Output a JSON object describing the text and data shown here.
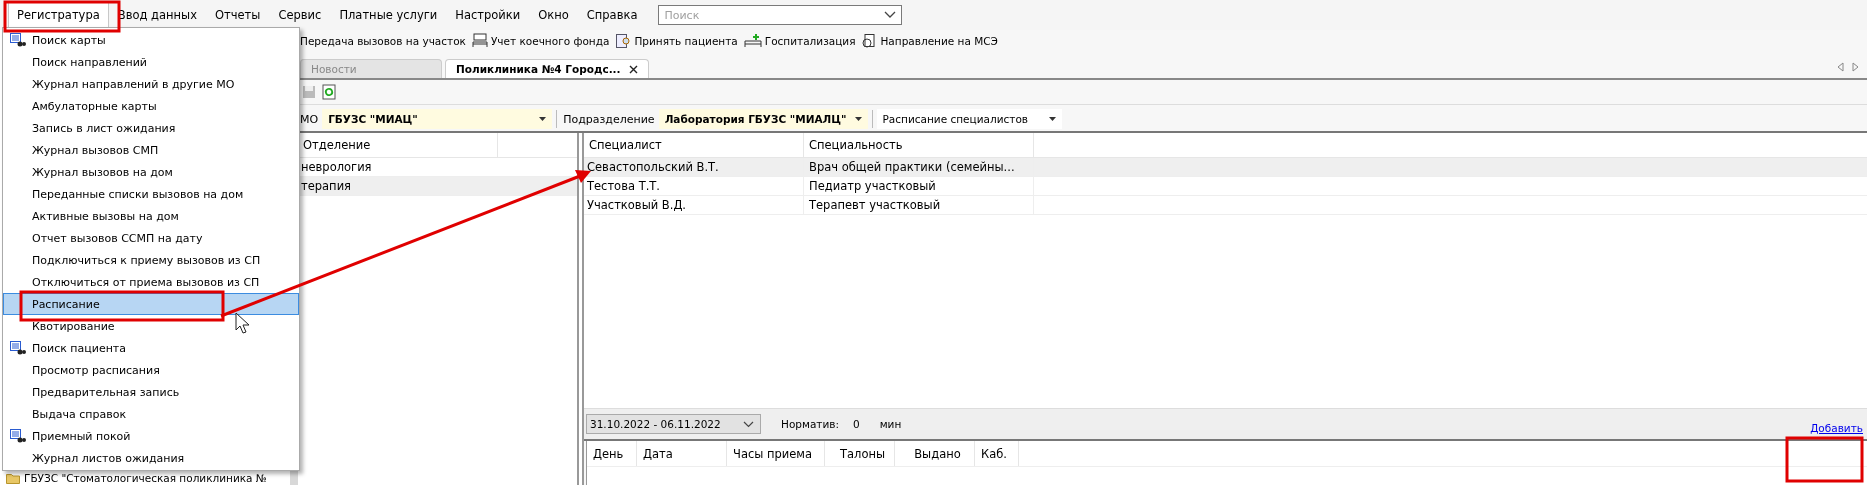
{
  "menu_bar": [
    {
      "label": "Регистратура",
      "selected": true
    },
    {
      "label": "Ввод данных",
      "selected": false
    },
    {
      "label": "Отчеты",
      "selected": false
    },
    {
      "label": "Сервис",
      "selected": false
    },
    {
      "label": "Платные услуги",
      "selected": false
    },
    {
      "label": "Настройки",
      "selected": false
    },
    {
      "label": "Окно",
      "selected": false
    },
    {
      "label": "Справка",
      "selected": false
    }
  ],
  "search": {
    "placeholder": "Поиск"
  },
  "toolbar": [
    {
      "label": "Передача вызовов на участок",
      "kind": "none"
    },
    {
      "label": "Учет коечного фонда",
      "kind": "bed-grid"
    },
    {
      "label": "Принять пациента",
      "kind": "patient"
    },
    {
      "label": "Госпитализация",
      "kind": "bed"
    },
    {
      "label": "Направление на МСЭ",
      "kind": "document"
    }
  ],
  "tabs": [
    {
      "label": "Новости",
      "selected": false,
      "closable": false
    },
    {
      "label": "Поликлиника №4 Городс...",
      "selected": true,
      "closable": true
    }
  ],
  "filters": {
    "mo_label": "МО",
    "mo_value": "ГБУЗС \"МИАЦ\"",
    "unit_label": "Подразделение",
    "unit_value": "Лаборатория ГБУЗС \"МИАЛЦ\"",
    "mode_value": "Расписание специалистов"
  },
  "departments": {
    "columns": [
      "Отделение"
    ],
    "rows": [
      {
        "name": "неврология",
        "selected": false
      },
      {
        "name": "терапия",
        "selected": true
      }
    ]
  },
  "specialists": {
    "columns": [
      "Специалист",
      "Специальность"
    ],
    "rows": [
      {
        "name": "Севастопольский В.Т.",
        "specialty": "Врач общей практики (семейны...",
        "selected": true
      },
      {
        "name": "Тестова Т.Т.",
        "specialty": "Педиатр участковый",
        "selected": false
      },
      {
        "name": "Участковый В.Д.",
        "specialty": "Терапевт участковый",
        "selected": false
      }
    ]
  },
  "schedule": {
    "period": "31.10.2022 - 06.11.2022",
    "norm_label": "Норматив:",
    "norm_value": "0",
    "norm_unit": "мин",
    "add_link": "Добавить",
    "columns": [
      "День",
      "Дата",
      "Часы приема",
      "Талоны",
      "Выдано",
      "Каб."
    ]
  },
  "tree": {
    "items": [
      "ГБУЗС \"Стоматологическая поликлиника №"
    ]
  },
  "dropdown_menu": [
    {
      "label": "Поиск карты",
      "icon": true,
      "selected": false
    },
    {
      "label": "Поиск направлений",
      "icon": false,
      "selected": false
    },
    {
      "label": "Журнал направлений в другие МО",
      "icon": false,
      "selected": false
    },
    {
      "label": "Амбулаторные карты",
      "icon": false,
      "selected": false
    },
    {
      "label": "Запись в лист ожидания",
      "icon": false,
      "selected": false
    },
    {
      "label": "Журнал вызовов СМП",
      "icon": false,
      "selected": false
    },
    {
      "label": "Журнал вызовов на дом",
      "icon": false,
      "selected": false
    },
    {
      "label": "Переданные списки вызовов на дом",
      "icon": false,
      "selected": false
    },
    {
      "label": "Активные вызовы на дом",
      "icon": false,
      "selected": false
    },
    {
      "label": "Отчет вызовов ССМП на дату",
      "icon": false,
      "selected": false
    },
    {
      "label": "Подключиться к приему вызовов из СП",
      "icon": false,
      "selected": false
    },
    {
      "label": "Отключиться от приема вызовов из СП",
      "icon": false,
      "selected": false
    },
    {
      "label": "Расписание",
      "icon": false,
      "selected": true
    },
    {
      "label": "Квотирование",
      "icon": false,
      "selected": false
    },
    {
      "label": "Поиск пациента",
      "icon": true,
      "selected": false
    },
    {
      "label": "Просмотр расписания",
      "icon": false,
      "selected": false
    },
    {
      "label": "Предварительная запись",
      "icon": false,
      "selected": false
    },
    {
      "label": "Выдача справок",
      "icon": false,
      "selected": false
    },
    {
      "label": "Приемный покой",
      "icon": true,
      "selected": false
    },
    {
      "label": "Журнал листов ожидания",
      "icon": false,
      "selected": false
    }
  ]
}
